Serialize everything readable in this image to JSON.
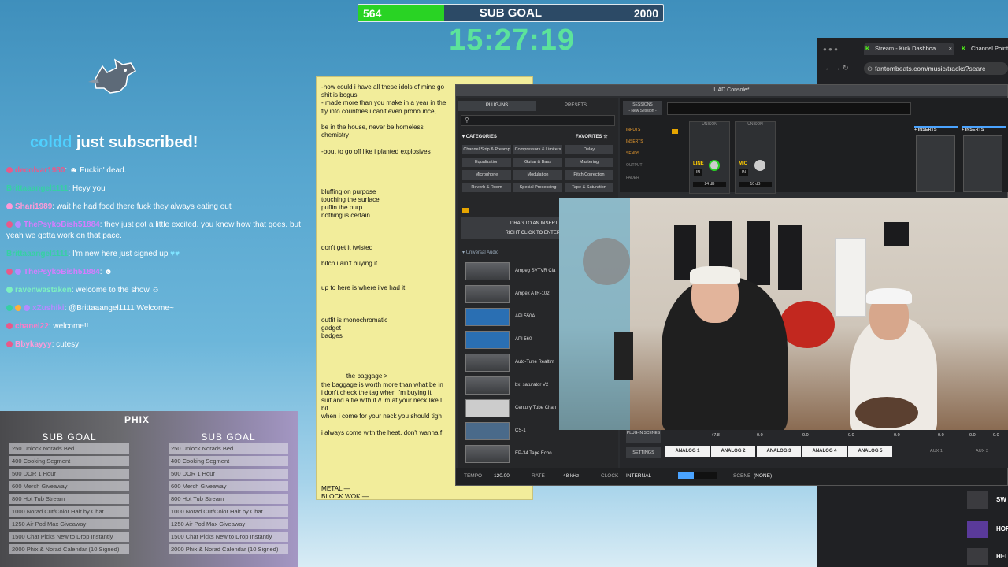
{
  "sub_goal": {
    "label": "SUB GOAL",
    "current": "564",
    "target": "2000",
    "progress": 0.282
  },
  "timer": "15:27:19",
  "sub_alert": {
    "user": "coldd",
    "text": "just subscribed!"
  },
  "chat": [
    {
      "user": "decolvar1980",
      "text": "Fuckin' dead.",
      "color": "#e85a8a"
    },
    {
      "user": "Brittaaangel1111",
      "text": "Heyy you",
      "color": "#36d0a3"
    },
    {
      "user": "Shari1989",
      "text": "wait he had food there fuck they always eating out",
      "color": "#ff9ad8"
    },
    {
      "user": "ThePsykoBish51884",
      "text": "they just got a little excited. you know how that goes. but yeah we gotta work on that pace.",
      "color": "#d77cff"
    },
    {
      "user": "Brittaaangel1111",
      "text": "I'm new here just signed up",
      "color": "#36d0a3"
    },
    {
      "user": "ThePsykoBish51884",
      "text": "",
      "color": "#d77cff"
    },
    {
      "user": "ravenwastaken",
      "text": "welcome to the show",
      "color": "#7df0c0"
    },
    {
      "user": "xZushiki",
      "text": "@Brittaaangel1111 Welcome~",
      "color": "#b48bff"
    },
    {
      "user": "chanel22",
      "text": "welcome!!",
      "color": "#ff7ac8"
    },
    {
      "user": "Bbykayyy",
      "text": "cutesy",
      "color": "#ff9ad8"
    }
  ],
  "goal_panel": {
    "title": "SUB GOAL",
    "logo": "PHIX",
    "items": [
      "250 Unlock Norads Bed",
      "400 Cooking Segment",
      "500 DOR 1 Hour",
      "600 Merch Giveaway",
      "800 Hot Tub Stream",
      "1000 Norad Cut/Color Hair by Chat",
      "1250 Air Pod Max Giveaway",
      "1500 Chat Picks New to Drop Instantly",
      "2000 Phix & Norad Calendar (10 Signed)"
    ]
  },
  "notes": "-how could i have all these idols of mine go\nshit is bogus\n- made more than you make in a year in the\nfly into countries i can't even pronounce,\n\nbe in the house, never be homeless\nchemistry\n\n-bout to go off like i planted explosives\n\n\n\n\nbluffing on purpose\ntouching the surface\npuffin the purp\nnothing is certain\n\n\n\ndon't get it twisted\n\nbitch i ain't buying it\n\n\nup to here is where i've had it\n\n\n\noutfit is monochromatic\ngadget\nbadges\n\n\n\n\n              the baggage >\nthe baggage is worth more than what be in\ni don't check the tag when i'm buying it\nsuit and a tie with it // im at your neck like l\nbit\nwhen i come for your neck you should tigh\n\ni always come with the heat, don't wanna f\n\n\n\n\n\n\nMETAL —\nBLOCK WOK —",
  "uad": {
    "title": "UAD Console*",
    "tabs": [
      "PLUG-INS",
      "PRESETS"
    ],
    "categories_label": "CATEGORIES",
    "favorites_label": "FAVORITES",
    "categories": [
      "Channel Strip & Preamp",
      "Compressors & Limiters",
      "Delay",
      "Equalization",
      "Guitar & Bass",
      "Mastering",
      "Microphone",
      "Modulation",
      "Pitch Correction",
      "Reverb & Room",
      "Special Processing",
      "Tape & Saturation"
    ],
    "drag_hint": "DRAG TO AN INSERT TO",
    "right_hint": "RIGHT CLICK TO ENTER ASS",
    "vendor": "Universal Audio",
    "plugins": [
      "Ampeg SVTVR Cla",
      "Ampex ATR-102",
      "API 550A",
      "API 560",
      "Auto-Tune Realtim",
      "bx_saturator V2",
      "Century Tube Chan",
      "CS-1",
      "EP-34 Tape Echo"
    ],
    "session": "SESSIONS",
    "session_name": "- New Session -",
    "routing": [
      "INPUTS",
      "INSERTS",
      "SENDS",
      "OUTPUT",
      "FADER"
    ],
    "channels": [
      {
        "name": "LINE",
        "sub": "IN",
        "gain": "24 dB"
      },
      {
        "name": "MIC",
        "sub": "IN",
        "gain": "10 dB"
      }
    ],
    "unison": "UNISON",
    "inserts_label": "INSERTS",
    "buses": [
      "ANALOG 1",
      "ANALOG 2",
      "ANALOG 3",
      "ANALOG 4",
      "ANALOG 5"
    ],
    "aux": [
      "AUX 1",
      "AUX 3"
    ],
    "levels": [
      "+7.8",
      "0.0",
      "0.0",
      "0.0",
      "0.0",
      "0.0",
      "0.0",
      "0.0"
    ],
    "plugin_scenes": "PLUG-IN SCENES",
    "settings": "SETTINGS",
    "tempo_label": "TEMPO",
    "tempo": "120.00",
    "rate_label": "RATE",
    "rate": "48 kHz",
    "clock_label": "CLOCK",
    "clock": "INTERNAL",
    "scene_label": "SCENE",
    "scene": "(NONE)"
  },
  "browser": {
    "tabs": [
      "Stream - Kick Dashboa",
      "Channel Point"
    ],
    "url": "fantombeats.com/music/tracks?searc"
  },
  "playlist": [
    "SW",
    "HOR",
    "HEL"
  ],
  "colors": {
    "goal_fill": "#29d324",
    "timer": "#5ce39b",
    "alert_user": "#4fd0ff",
    "notes_bg": "#f2ed9b"
  }
}
